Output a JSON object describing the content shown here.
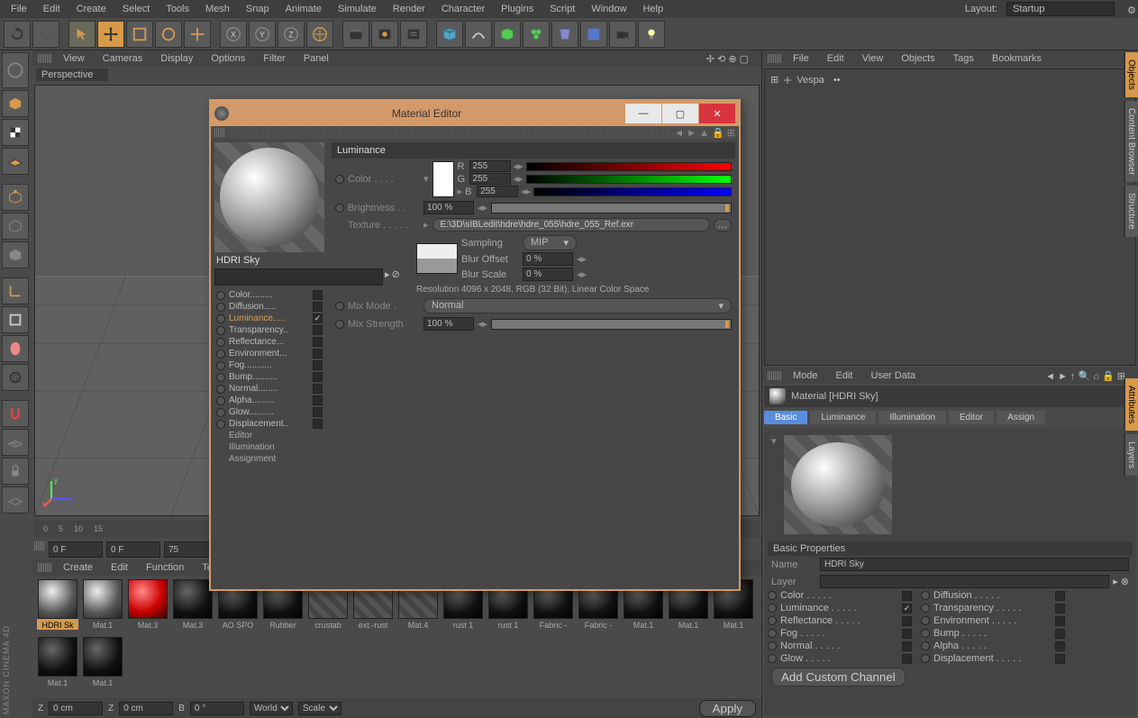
{
  "menubar": [
    "File",
    "Edit",
    "Create",
    "Select",
    "Tools",
    "Mesh",
    "Snap",
    "Animate",
    "Simulate",
    "Render",
    "Character",
    "Plugins",
    "Script",
    "Window",
    "Help"
  ],
  "layout_label": "Layout:",
  "layout_value": "Startup",
  "viewport_menu": [
    "View",
    "Cameras",
    "Display",
    "Options",
    "Filter",
    "Panel"
  ],
  "viewport_label": "Perspective",
  "timeline_frames": [
    "0",
    "5",
    "10",
    "15"
  ],
  "timeline": {
    "start": "0 F",
    "cur": "0 F",
    "end": "75"
  },
  "materials_menu": [
    "Create",
    "Edit",
    "Function",
    "Texture"
  ],
  "materials": [
    "HDRI Sk",
    "Mat.1",
    "Mat.3",
    "Mat.3",
    "AO SPO",
    "Rubber",
    "crustab",
    "ext.-rust",
    "Mat.4",
    "rust 1",
    "rust 1",
    "Fabric -",
    "Fabric -",
    "Mat.1",
    "Mat.1",
    "Mat.1",
    "Mat.1",
    "Mat.1"
  ],
  "coord": {
    "z1l": "Z",
    "z1": "0 cm",
    "z2l": "Z",
    "z2": "0 cm",
    "bl": "B",
    "b": "0 °",
    "world": "World",
    "scale": "Scale",
    "apply": "Apply"
  },
  "objects_menu": [
    "File",
    "Edit",
    "View",
    "Objects",
    "Tags",
    "Bookmarks"
  ],
  "object_root": "Vespa",
  "attr_menu": [
    "Mode",
    "Edit",
    "User Data"
  ],
  "attr_title": "Material [HDRI Sky]",
  "attr_tabs": [
    "Basic",
    "Luminance",
    "Illumination",
    "Editor",
    "Assign"
  ],
  "basic_section": "Basic Properties",
  "basic": {
    "name_label": "Name",
    "name": "HDRI Sky",
    "layer_label": "Layer",
    "layer": "",
    "channels": [
      {
        "l": "Color",
        "on": false
      },
      {
        "l": "Diffusion",
        "on": false
      },
      {
        "l": "Luminance",
        "on": true
      },
      {
        "l": "Transparency",
        "on": false
      },
      {
        "l": "Reflectance",
        "on": false
      },
      {
        "l": "Environment",
        "on": false
      },
      {
        "l": "Fog",
        "on": false
      },
      {
        "l": "Bump",
        "on": false
      },
      {
        "l": "Normal",
        "on": false
      },
      {
        "l": "Alpha",
        "on": false
      },
      {
        "l": "Glow",
        "on": false
      },
      {
        "l": "Displacement",
        "on": false
      }
    ],
    "add": "Add Custom Channel"
  },
  "right_tabs": [
    "Objects",
    "Content Browser",
    "Structure",
    "Attributes",
    "Layers"
  ],
  "mat_editor": {
    "title": "Material Editor",
    "name": "HDRI Sky",
    "channels": [
      {
        "l": "Color",
        "on": false
      },
      {
        "l": "Diffusion",
        "on": false
      },
      {
        "l": "Luminance",
        "on": true,
        "active": true
      },
      {
        "l": "Transparency",
        "on": false
      },
      {
        "l": "Reflectance",
        "on": false
      },
      {
        "l": "Environment",
        "on": false
      },
      {
        "l": "Fog",
        "on": false
      },
      {
        "l": "Bump",
        "on": false
      },
      {
        "l": "Normal",
        "on": false
      },
      {
        "l": "Alpha",
        "on": false
      },
      {
        "l": "Glow",
        "on": false
      },
      {
        "l": "Displacement",
        "on": false
      }
    ],
    "subs": [
      "Editor",
      "Illumination",
      "Assignment"
    ],
    "section": "Luminance",
    "color_label": "Color",
    "r": "255",
    "g": "255",
    "b": "255",
    "brightness_label": "Brightness",
    "brightness": "100 %",
    "texture_label": "Texture",
    "texture_path": "E:\\3D\\sIBLedit\\hdre\\hdre_055\\hdre_055_Ref.exr",
    "sampling_label": "Sampling",
    "sampling": "MIP",
    "blur_offset_label": "Blur Offset",
    "blur_offset": "0 %",
    "blur_scale_label": "Blur Scale",
    "blur_scale": "0 %",
    "resolution": "Resolution 4096 x 2048, RGB (32 Bit), Linear Color Space",
    "mix_mode_label": "Mix Mode",
    "mix_mode": "Normal",
    "mix_strength_label": "Mix Strength",
    "mix_strength": "100 %"
  },
  "logo": "MAXON CINEMA 4D"
}
